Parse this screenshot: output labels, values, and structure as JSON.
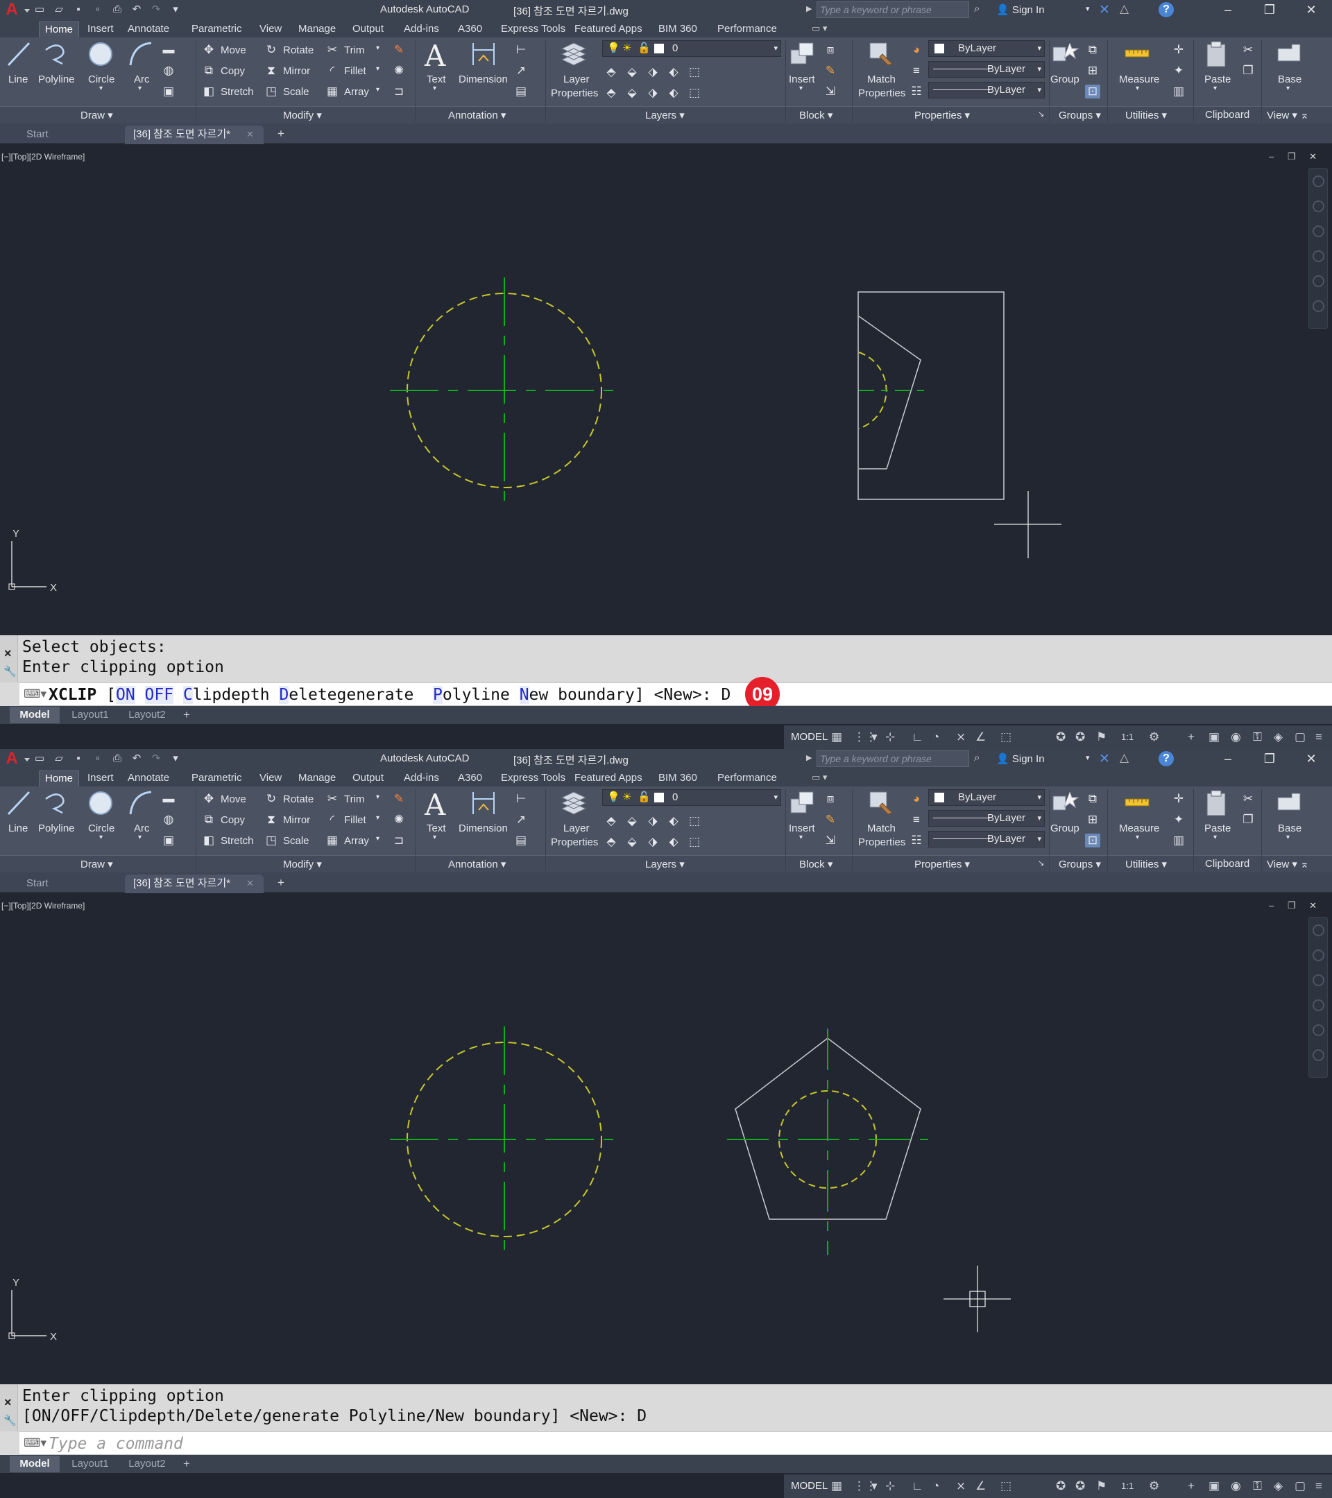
{
  "app": {
    "name": "Autodesk AutoCAD",
    "file_title": "[36] 참조 도면 자르기.dwg",
    "search_placeholder": "Type a keyword or phrase",
    "sign_in": "Sign In"
  },
  "ribbon_tabs": [
    "Home",
    "Insert",
    "Annotate",
    "Parametric",
    "View",
    "Manage",
    "Output",
    "Add-ins",
    "A360",
    "Express Tools",
    "Featured Apps",
    "BIM 360",
    "Performance"
  ],
  "ribbon": {
    "draw": {
      "line": "Line",
      "polyline": "Polyline",
      "circle": "Circle",
      "arc": "Arc",
      "title": "Draw"
    },
    "modify": {
      "move": "Move",
      "rotate": "Rotate",
      "trim": "Trim",
      "copy": "Copy",
      "mirror": "Mirror",
      "fillet": "Fillet",
      "stretch": "Stretch",
      "scale": "Scale",
      "array": "Array",
      "title": "Modify"
    },
    "annotation": {
      "text": "Text",
      "dimension": "Dimension",
      "title": "Annotation"
    },
    "layers": {
      "layer_properties_1": "Layer",
      "layer_properties_2": "Properties",
      "current_layer": "0",
      "title": "Layers"
    },
    "block": {
      "insert": "Insert",
      "title": "Block"
    },
    "properties": {
      "match_1": "Match",
      "match_2": "Properties",
      "color": "ByLayer",
      "linetype": "ByLayer",
      "lineweight": "ByLayer",
      "title": "Properties"
    },
    "groups": {
      "group": "Group",
      "title": "Groups"
    },
    "utilities": {
      "measure": "Measure",
      "title": "Utilities"
    },
    "clipboard": {
      "paste": "Paste",
      "title": "Clipboard"
    },
    "view": {
      "base": "Base",
      "title": "View"
    }
  },
  "doc_tabs": {
    "start": "Start",
    "file": "[36] 참조 도면 자르기*"
  },
  "viewport": {
    "label": "[−][Top][2D Wireframe]",
    "axis_x": "X",
    "axis_y": "Y"
  },
  "layout_tabs": [
    "Model",
    "Layout1",
    "Layout2"
  ],
  "status": {
    "model": "MODEL",
    "scale": "1:1"
  },
  "colors": {
    "centerline": "#0fae1e",
    "hidden_line": "#c8c82a",
    "object_line": "#c8cbd2",
    "badge": "#e5202a"
  },
  "top": {
    "history": [
      "Select objects:",
      "Enter clipping option"
    ],
    "command": {
      "name": "XCLIP",
      "open": "[",
      "options": [
        {
          "hotkey": "ON",
          "rest": ""
        },
        {
          "hotkey": "OFF",
          "rest": ""
        },
        {
          "hotkey": "C",
          "rest": "lipdepth"
        },
        {
          "hotkey": "D",
          "rest": "elete"
        },
        {
          "hotkey": "",
          "rest": "generate "
        },
        {
          "hotkey": "P",
          "rest": "olyline"
        },
        {
          "hotkey": "N",
          "rest": "ew"
        },
        {
          "hotkey": "",
          "rest": " boundary"
        }
      ],
      "close": "] <New>:",
      "typed": "D"
    },
    "badge": "09"
  },
  "bottom": {
    "history": [
      "Enter clipping option",
      "[ON/OFF/Clipdepth/Delete/generate Polyline/New boundary] <New>: D"
    ],
    "placeholder": "Type a command"
  }
}
